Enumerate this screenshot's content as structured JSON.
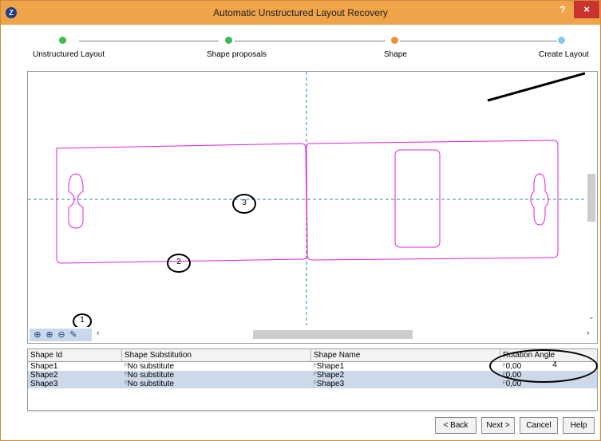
{
  "window": {
    "title": "Automatic Unstructured Layout Recovery",
    "help_label": "?",
    "close_label": "×",
    "app_icon": "app-logo-icon"
  },
  "wizard": {
    "steps": [
      {
        "label": "Unstructured Layout",
        "state": "completed",
        "color": "#3cba54"
      },
      {
        "label": "Shape proposals",
        "state": "completed",
        "color": "#3cba54"
      },
      {
        "label": "Shape",
        "state": "current",
        "color": "#f0922b"
      },
      {
        "label": "Create Layout",
        "state": "pending",
        "color": "#8ec5ea"
      }
    ]
  },
  "canvas": {
    "shape_color": "#e020e0",
    "axis_color": "#2a8aa8",
    "zoom_tools": [
      {
        "icon": "zoom-fit-icon",
        "glyph": "⊕"
      },
      {
        "icon": "zoom-in-icon",
        "glyph": "⊕"
      },
      {
        "icon": "zoom-out-icon",
        "glyph": "⊖"
      },
      {
        "icon": "pan-tool-icon",
        "glyph": "✎"
      }
    ],
    "hscroll_left": "‹",
    "hscroll_right": "›",
    "vscroll_down": "⌄"
  },
  "annotations": {
    "callout_1": "1",
    "callout_2": "2",
    "callout_3": "3",
    "callout_4": "4"
  },
  "table": {
    "columns": [
      "Shape Id",
      "Shape Substitution",
      "Shape Name",
      "Rotation Angle"
    ],
    "rows": [
      {
        "id": "Shape1",
        "substitution": "No substitute",
        "name": "Shape1",
        "angle": "0,00"
      },
      {
        "id": "Shape2",
        "substitution": "No substitute",
        "name": "Shape2",
        "angle": "0,00"
      },
      {
        "id": "Shape3",
        "substitution": "No substitute",
        "name": "Shape3",
        "angle": "0,00"
      }
    ],
    "row_colors": [
      "#ffffff",
      "#cbd9e8",
      "#cbd9e8"
    ],
    "cell_marker": "F"
  },
  "buttons": {
    "back": "< Back",
    "next": "Next >",
    "cancel": "Cancel",
    "help": "Help"
  }
}
